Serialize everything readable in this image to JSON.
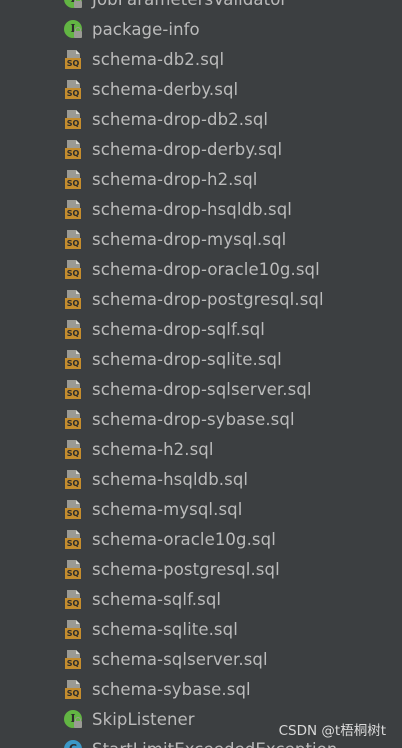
{
  "files": [
    {
      "label": "JobParametersValidator",
      "icon": "interface-icon"
    },
    {
      "label": "package-info",
      "icon": "interface-icon"
    },
    {
      "label": "schema-db2.sql",
      "icon": "sql-file-icon"
    },
    {
      "label": "schema-derby.sql",
      "icon": "sql-file-icon"
    },
    {
      "label": "schema-drop-db2.sql",
      "icon": "sql-file-icon"
    },
    {
      "label": "schema-drop-derby.sql",
      "icon": "sql-file-icon"
    },
    {
      "label": "schema-drop-h2.sql",
      "icon": "sql-file-icon"
    },
    {
      "label": "schema-drop-hsqldb.sql",
      "icon": "sql-file-icon"
    },
    {
      "label": "schema-drop-mysql.sql",
      "icon": "sql-file-icon"
    },
    {
      "label": "schema-drop-oracle10g.sql",
      "icon": "sql-file-icon"
    },
    {
      "label": "schema-drop-postgresql.sql",
      "icon": "sql-file-icon"
    },
    {
      "label": "schema-drop-sqlf.sql",
      "icon": "sql-file-icon"
    },
    {
      "label": "schema-drop-sqlite.sql",
      "icon": "sql-file-icon"
    },
    {
      "label": "schema-drop-sqlserver.sql",
      "icon": "sql-file-icon"
    },
    {
      "label": "schema-drop-sybase.sql",
      "icon": "sql-file-icon"
    },
    {
      "label": "schema-h2.sql",
      "icon": "sql-file-icon"
    },
    {
      "label": "schema-hsqldb.sql",
      "icon": "sql-file-icon"
    },
    {
      "label": "schema-mysql.sql",
      "icon": "sql-file-icon"
    },
    {
      "label": "schema-oracle10g.sql",
      "icon": "sql-file-icon"
    },
    {
      "label": "schema-postgresql.sql",
      "icon": "sql-file-icon"
    },
    {
      "label": "schema-sqlf.sql",
      "icon": "sql-file-icon"
    },
    {
      "label": "schema-sqlite.sql",
      "icon": "sql-file-icon"
    },
    {
      "label": "schema-sqlserver.sql",
      "icon": "sql-file-icon"
    },
    {
      "label": "schema-sybase.sql",
      "icon": "sql-file-icon"
    },
    {
      "label": "SkipListener",
      "icon": "interface-icon"
    },
    {
      "label": "StartLimitExceededException",
      "icon": "class-icon"
    }
  ],
  "icon_text": {
    "sql_badge": "SQ",
    "interface_letter": "I",
    "class_letter": "C"
  },
  "watermark": "CSDN @t梧桐树t",
  "colors": {
    "background": "#3c3f41",
    "text": "#bbbbbb",
    "sql_badge": "#c48d2e",
    "interface_icon": "#62b543",
    "class_icon": "#3b97c6"
  }
}
